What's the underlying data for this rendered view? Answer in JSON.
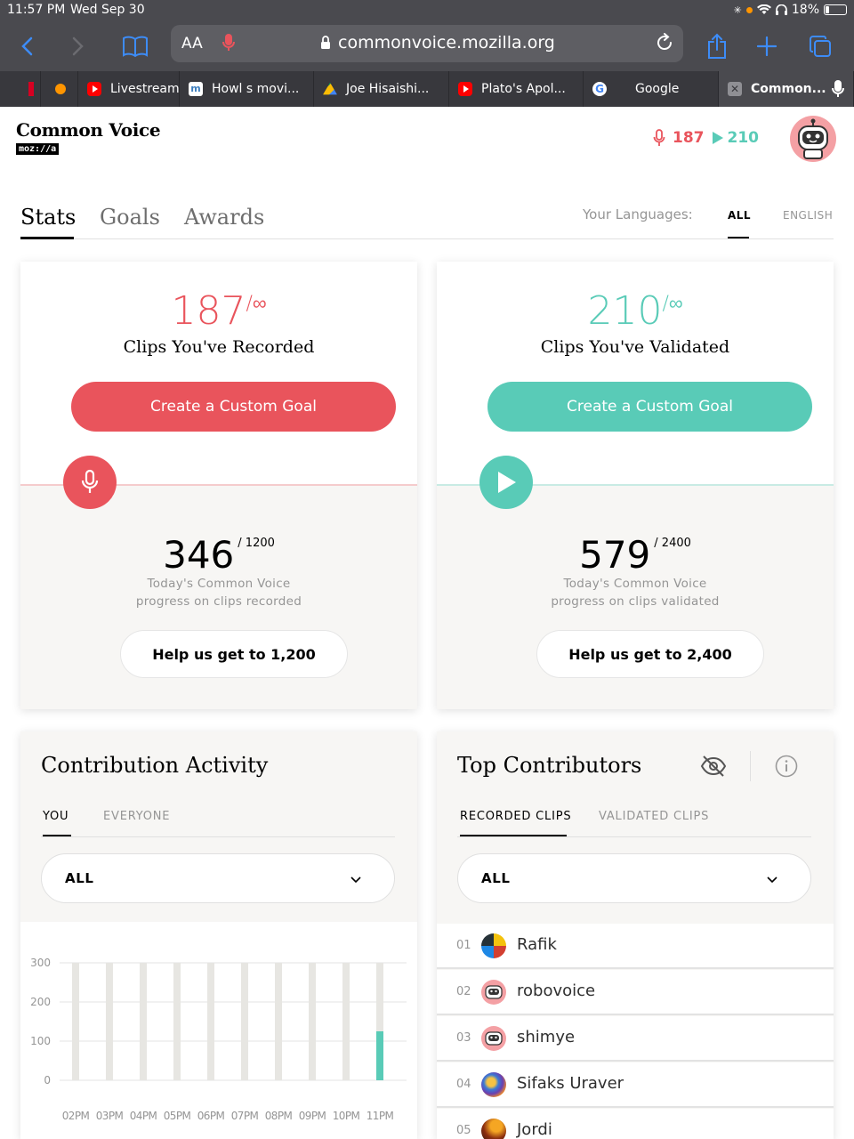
{
  "status": {
    "time": "11:57 PM",
    "date": "Wed Sep 30",
    "battery": "18%"
  },
  "browser": {
    "aa_label": "AA",
    "url": "commonvoice.mozilla.org",
    "tabs": [
      {
        "label": "Livestream",
        "icon": "youtube-icon"
      },
      {
        "label": "Howl s movi...",
        "icon": "site-icon"
      },
      {
        "label": "Joe Hisaishi...",
        "icon": "google-drive-icon"
      },
      {
        "label": "Plato's Apol...",
        "icon": "youtube-icon"
      },
      {
        "label": "Google",
        "icon": "google-icon"
      },
      {
        "label": "Common...",
        "icon": "close-tab-icon",
        "active": true
      }
    ]
  },
  "header": {
    "logo_title": "Common Voice",
    "logo_sub": "moz://a",
    "recorded_count": "187",
    "validated_count": "210"
  },
  "page_tabs": {
    "stats": "Stats",
    "goals": "Goals",
    "awards": "Awards"
  },
  "languages": {
    "label": "Your Languages:",
    "all": "ALL",
    "english": "ENGLISH"
  },
  "recorded_card": {
    "count": "187",
    "limit": "/∞",
    "label": "Clips You've Recorded",
    "goal_button": "Create a Custom Goal",
    "progress": "346",
    "progress_goal": "/ 1200",
    "progress_desc_1": "Today's Common Voice",
    "progress_desc_2": "progress on clips recorded",
    "help_button": "Help us get to 1,200"
  },
  "validated_card": {
    "count": "210",
    "limit": "/∞",
    "label": "Clips You've Validated",
    "goal_button": "Create a Custom Goal",
    "progress": "579",
    "progress_goal": "/ 2400",
    "progress_desc_1": "Today's Common Voice",
    "progress_desc_2": "progress on clips validated",
    "help_button": "Help us get to 2,400"
  },
  "activity": {
    "title": "Contribution Activity",
    "tab_you": "YOU",
    "tab_everyone": "EVERYONE",
    "filter": "ALL"
  },
  "chart_data": {
    "type": "bar",
    "categories": [
      "02PM",
      "03PM",
      "04PM",
      "05PM",
      "06PM",
      "07PM",
      "08PM",
      "09PM",
      "10PM",
      "11PM"
    ],
    "values": [
      0,
      0,
      0,
      0,
      0,
      0,
      0,
      0,
      0,
      125
    ],
    "yticks": [
      "300",
      "200",
      "100",
      "0"
    ],
    "ylim": [
      0,
      300
    ],
    "xlabel": "",
    "ylabel": "",
    "bar_color": "#59cbb7",
    "track_color": "#e7e6e2"
  },
  "contributors": {
    "title": "Top Contributors",
    "tab_recorded": "RECORDED CLIPS",
    "tab_validated": "VALIDATED CLIPS",
    "filter": "ALL",
    "rows": [
      {
        "rank": "01",
        "name": "Rafik"
      },
      {
        "rank": "02",
        "name": "robovoice"
      },
      {
        "rank": "03",
        "name": "shimye"
      },
      {
        "rank": "04",
        "name": "Sifaks Uraver"
      },
      {
        "rank": "05",
        "name": "Jordi"
      }
    ]
  },
  "colors": {
    "record": "#e9545c",
    "validate": "#59cbb7"
  }
}
